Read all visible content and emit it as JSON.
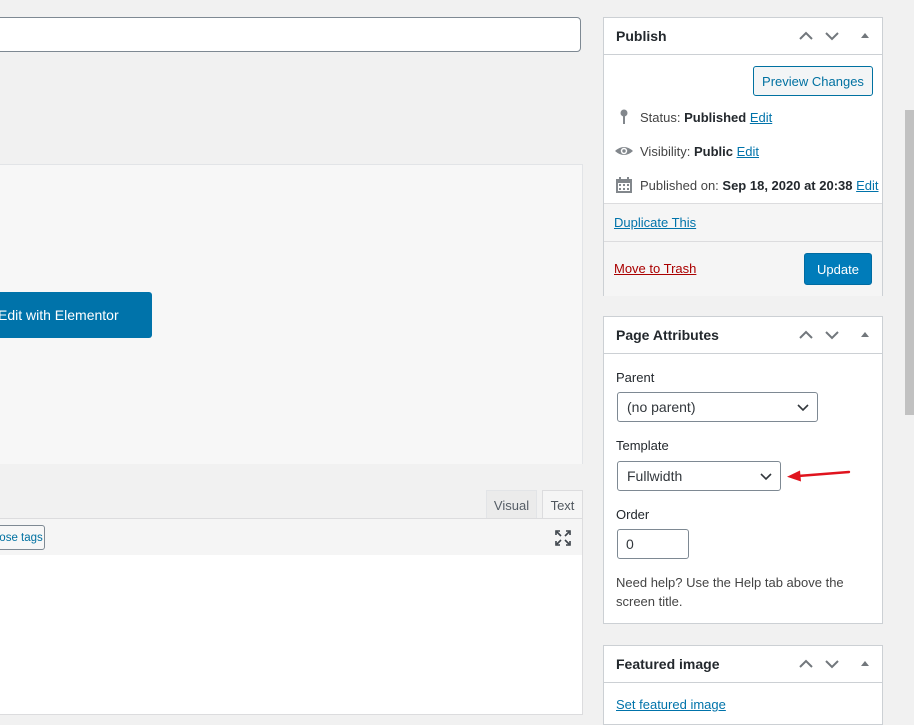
{
  "editor": {
    "elementor_button": "Edit with Elementor",
    "tabs": {
      "visual": "Visual",
      "text": "Text"
    },
    "toolbar": {
      "close_tags": "close tags"
    }
  },
  "publish_box": {
    "title": "Publish",
    "preview_button": "Preview Changes",
    "status_label": "Status:",
    "status_value": "Published",
    "visibility_label": "Visibility:",
    "visibility_value": "Public",
    "published_label": "Published on:",
    "published_value": "Sep 18, 2020 at 20:38",
    "edit_link": "Edit",
    "duplicate_link": "Duplicate This",
    "trash_link": "Move to Trash",
    "update_button": "Update"
  },
  "page_attributes": {
    "title": "Page Attributes",
    "parent_label": "Parent",
    "parent_value": "(no parent)",
    "template_label": "Template",
    "template_value": "Fullwidth",
    "order_label": "Order",
    "order_value": "0",
    "help_text": "Need help? Use the Help tab above the screen title."
  },
  "featured_image": {
    "title": "Featured image",
    "set_link": "Set featured image"
  },
  "colors": {
    "primary": "#0073aa",
    "update_button": "#007cba",
    "trash": "#aa0000",
    "annotation_arrow": "#e0141e"
  },
  "icons": [
    "chevron-up-icon",
    "chevron-down-icon",
    "toggle-arrow-icon",
    "pin-icon",
    "eye-icon",
    "calendar-icon",
    "fullscreen-icon",
    "red-arrow-icon"
  ]
}
